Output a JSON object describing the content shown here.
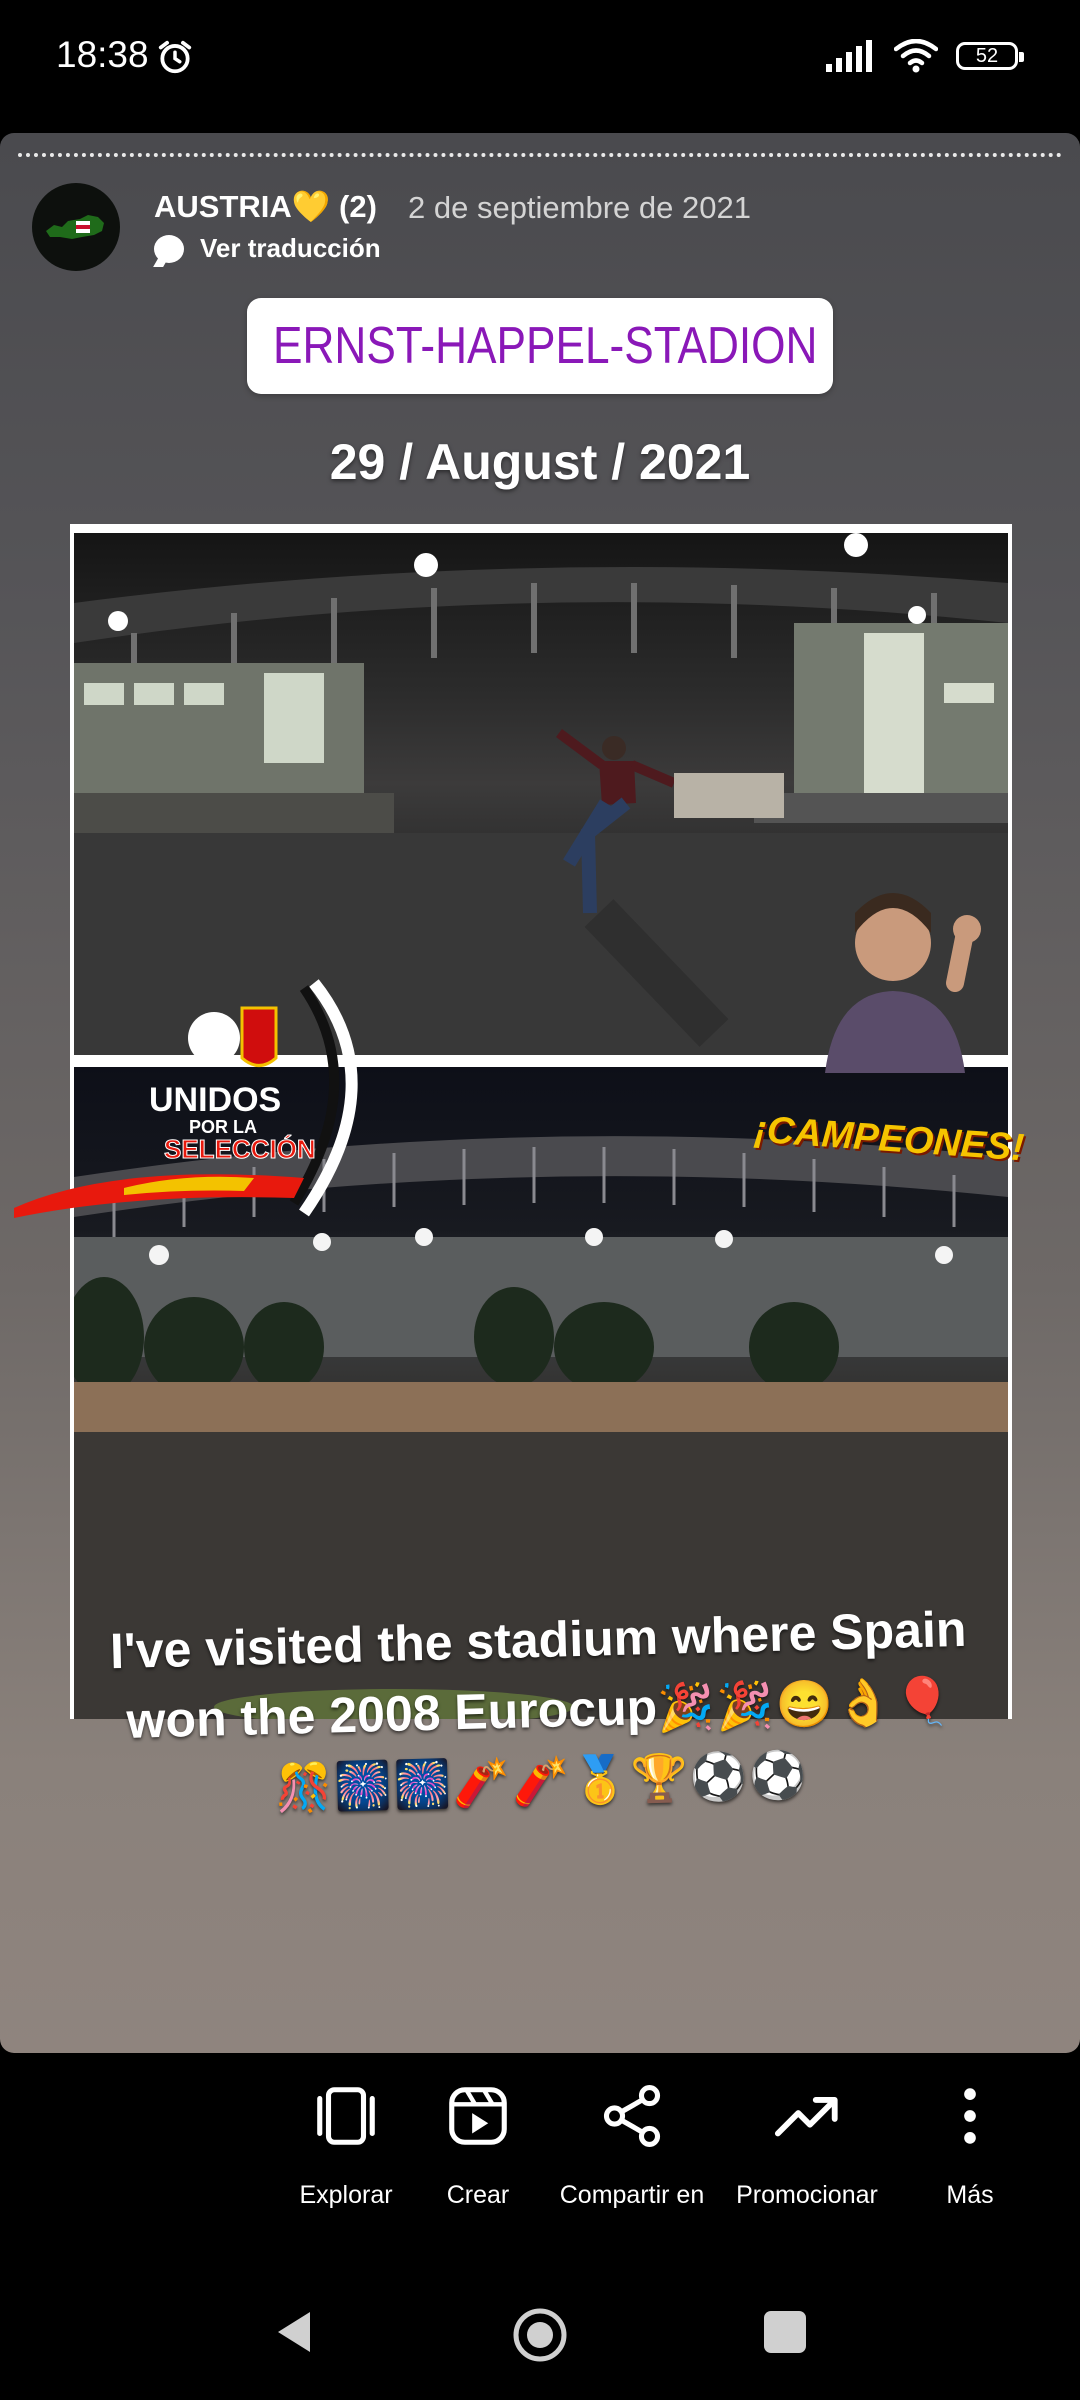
{
  "status_bar": {
    "time": "18:38",
    "battery": "52"
  },
  "story": {
    "username": "AUSTRIA💛",
    "count": "(2)",
    "date": "2 de septiembre de 2021",
    "translate_label": "Ver traducción",
    "location": "ERNST-HAPPEL-STADION",
    "story_date": "29 / August / 2021",
    "sticker_text": "¡CAMPEONES!",
    "badge_lines": [
      "UNIDOS",
      "POR LA",
      "SELECCIÓN"
    ],
    "caption_line1": "I've visited the stadium where Spain",
    "caption_line2": "won the 2008 Eurocup",
    "caption_emoji_line2": "🎉🎉😄👌🎈",
    "caption_emoji_line3": "🎊🎆🎆🧨🧨🥇🏆⚽⚽"
  },
  "actions": [
    {
      "label": "Explorar",
      "icon": "explore-icon"
    },
    {
      "label": "Crear",
      "icon": "reels-icon"
    },
    {
      "label": "Compartir en",
      "icon": "share-icon"
    },
    {
      "label": "Promocionar",
      "icon": "trending-icon"
    },
    {
      "label": "Más",
      "icon": "more-icon"
    }
  ],
  "colors": {
    "location_text": "#8a18b8",
    "background": "#000000"
  }
}
